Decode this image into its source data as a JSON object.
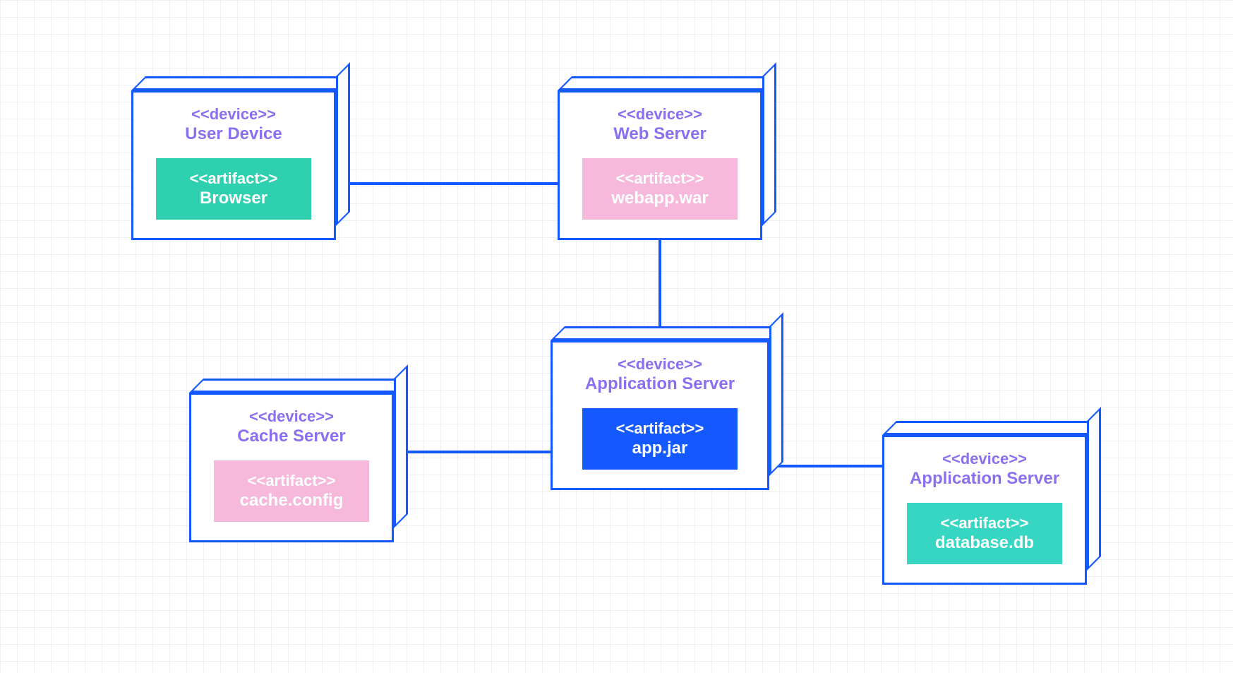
{
  "diagram": {
    "type": "uml-deployment",
    "grid_spacing": 24,
    "colors": {
      "stroke": "#1359ff",
      "label": "#8a6ff0",
      "artifact_teal": "#2fd0b0",
      "artifact_pink": "#f6b9dc",
      "artifact_blue": "#1359ff",
      "artifact_cyan": "#36d6c3"
    },
    "nodes": {
      "user_device": {
        "stereotype": "<<device>>",
        "name": "User Device",
        "artifact": {
          "stereotype": "<<artifact>>",
          "name": "Browser",
          "color": "teal"
        }
      },
      "web_server": {
        "stereotype": "<<device>>",
        "name": "Web Server",
        "artifact": {
          "stereotype": "<<artifact>>",
          "name": "webapp.war",
          "color": "pink"
        }
      },
      "app_server": {
        "stereotype": "<<device>>",
        "name": "Application Server",
        "artifact": {
          "stereotype": "<<artifact>>",
          "name": "app.jar",
          "color": "blue"
        }
      },
      "cache_server": {
        "stereotype": "<<device>>",
        "name": "Cache Server",
        "artifact": {
          "stereotype": "<<artifact>>",
          "name": "cache.config",
          "color": "pink"
        }
      },
      "db_server": {
        "stereotype": "<<device>>",
        "name": "Application Server",
        "artifact": {
          "stereotype": "<<artifact>>",
          "name": "database.db",
          "color": "cyan"
        }
      }
    },
    "edges": [
      {
        "from": "user_device",
        "to": "web_server"
      },
      {
        "from": "web_server",
        "to": "app_server"
      },
      {
        "from": "app_server",
        "to": "cache_server"
      },
      {
        "from": "app_server",
        "to": "db_server"
      }
    ]
  }
}
